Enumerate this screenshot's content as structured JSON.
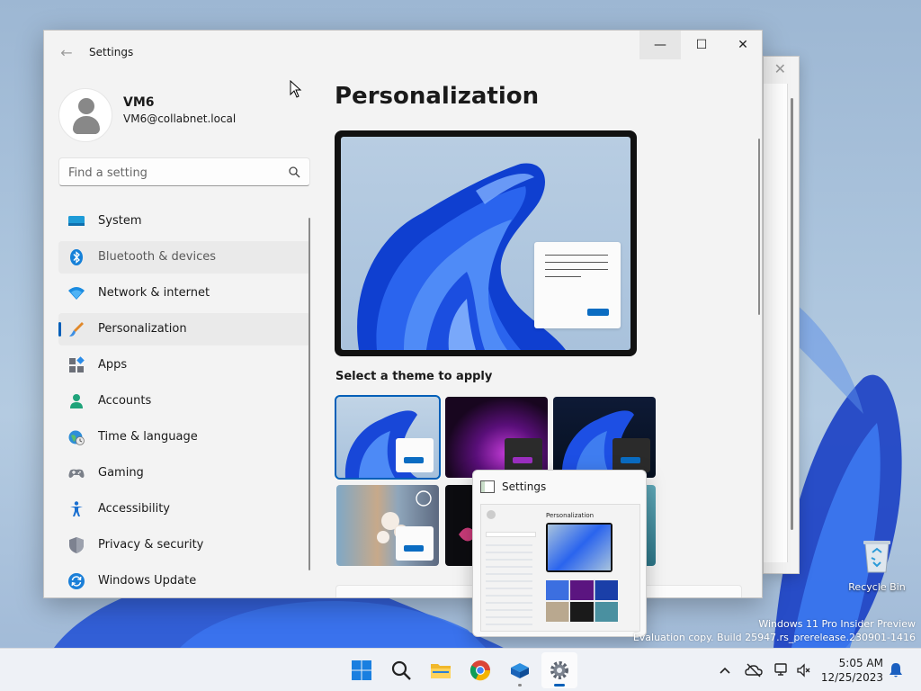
{
  "window": {
    "app_title": "Settings",
    "minimize_glyph": "—",
    "maximize_glyph": "☐",
    "close_glyph": "✕",
    "back_glyph": "←"
  },
  "profile": {
    "name": "VM6",
    "email": "VM6@collabnet.local"
  },
  "search": {
    "placeholder": "Find a setting"
  },
  "sidebar": {
    "items": [
      {
        "label": "System",
        "icon": "system-icon"
      },
      {
        "label": "Bluetooth & devices",
        "icon": "bluetooth-icon"
      },
      {
        "label": "Network & internet",
        "icon": "wifi-icon"
      },
      {
        "label": "Personalization",
        "icon": "brush-icon"
      },
      {
        "label": "Apps",
        "icon": "apps-icon"
      },
      {
        "label": "Accounts",
        "icon": "accounts-icon"
      },
      {
        "label": "Time & language",
        "icon": "globe-clock-icon"
      },
      {
        "label": "Gaming",
        "icon": "gamepad-icon"
      },
      {
        "label": "Accessibility",
        "icon": "accessibility-icon"
      },
      {
        "label": "Privacy & security",
        "icon": "shield-icon"
      },
      {
        "label": "Windows Update",
        "icon": "update-icon"
      }
    ],
    "selected": "Personalization"
  },
  "content": {
    "page_title": "Personalization",
    "theme_section_label": "Select a theme to apply"
  },
  "taskbar_thumbnail": {
    "title": "Settings",
    "mini_page_title": "Personalization"
  },
  "desktop": {
    "recycle_bin_label": "Recycle Bin",
    "watermark_line1": "Windows 11 Pro Insider Preview",
    "watermark_line2": "Evaluation copy. Build 25947.rs_prerelease.230901-1416"
  },
  "clock": {
    "time": "5:05 AM",
    "date": "12/25/2023"
  },
  "colors": {
    "accent": "#005fb8",
    "window_bg": "#f3f3f3",
    "taskbar_bg": "#eef1f6"
  }
}
